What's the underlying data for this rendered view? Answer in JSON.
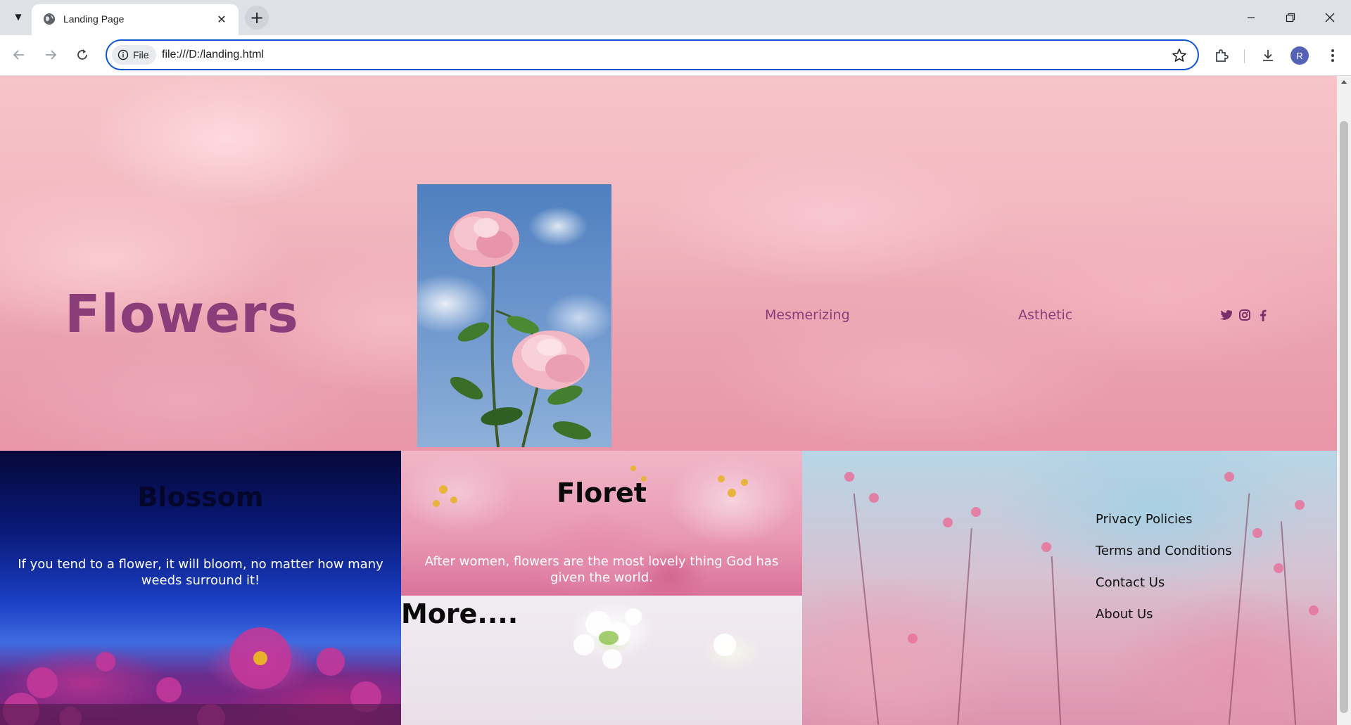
{
  "browser": {
    "tab_title": "Landing Page",
    "address_chip": "File",
    "url": "file:///D:/landing.html",
    "avatar_letter": "R"
  },
  "hero": {
    "title": "Flowers",
    "nav": [
      "Mesmerizing",
      "Asthetic"
    ],
    "social_icons": [
      "twitter-icon",
      "instagram-icon",
      "facebook-icon"
    ]
  },
  "cards": {
    "blossom": {
      "title": "Blossom",
      "text": "If you tend to a flower, it will bloom, no matter how many weeds surround it!"
    },
    "floret": {
      "title": "Floret",
      "text": "After women, flowers are the most lovely thing God has given the world."
    },
    "more": {
      "title": "More...."
    }
  },
  "footer": {
    "links": [
      "Privacy Policies",
      "Terms and Conditions",
      "Contact Us",
      "About Us"
    ]
  },
  "colors": {
    "accent": "#8b3d7a",
    "omnibox_border": "#0b57d0"
  }
}
